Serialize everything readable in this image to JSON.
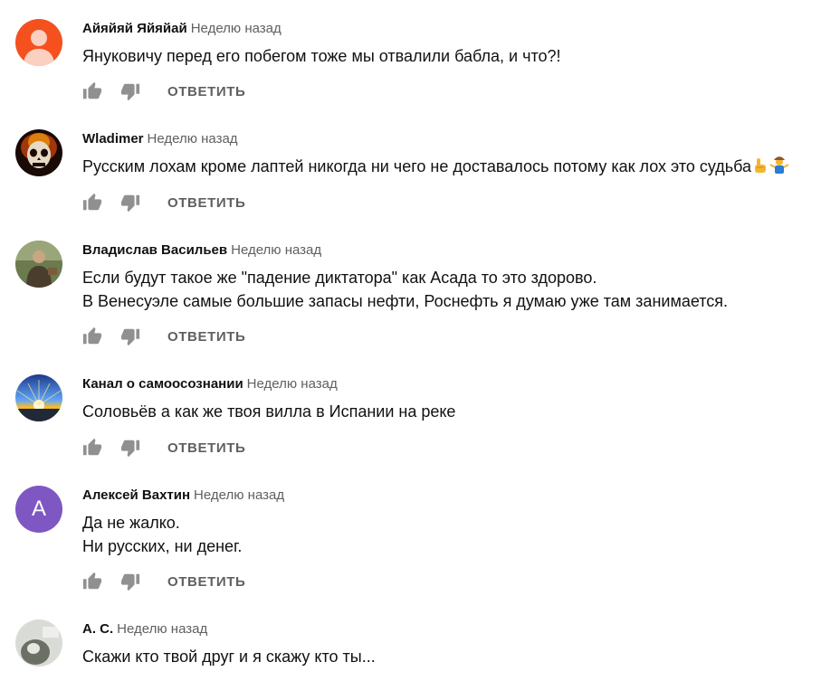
{
  "comments": [
    {
      "author": "Айяйяй Яйяйай",
      "time": "Неделю назад",
      "lines": [
        "Януковичу перед его побегом тоже мы отвалили бабла, и что?!"
      ],
      "reply": "ОТВЕТИТЬ",
      "avatar_icon": "default-person-avatar",
      "avatar_color": "#f4511e"
    },
    {
      "author": "Wladimer",
      "time": "Неделю назад",
      "lines": [
        "Русским лохам кроме лаптей никогда ни чего не доставалось потому как лох это судьба"
      ],
      "reply": "ОТВЕТИТЬ",
      "avatar_icon": "flaming-skull-avatar",
      "emojis": [
        "pointing-finger-emoji",
        "shrugging-person-emoji"
      ]
    },
    {
      "author": "Владислав Васильев",
      "time": "Неделю назад",
      "lines": [
        "Если будут такое же \"падение диктатора\" как Асада то это здорово.",
        "В Венесуэле самые большие запасы нефти, Роснефть я думаю уже там занимается."
      ],
      "reply": "ОТВЕТИТЬ",
      "avatar_icon": "person-photo-avatar"
    },
    {
      "author": "Канал о самоосознании",
      "time": "Неделю назад",
      "lines": [
        "Соловьёв а как же твоя вилла в Испании на реке"
      ],
      "reply": "ОТВЕТИТЬ",
      "avatar_icon": "sunset-avatar"
    },
    {
      "author": "Алексей Вахтин",
      "time": "Неделю назад",
      "lines": [
        "Да не жалко.",
        "Ни русских, ни денег."
      ],
      "reply": "ОТВЕТИТЬ",
      "avatar_letter": "А",
      "avatar_color": "#7e57c2"
    },
    {
      "author": "А. С.",
      "time": "Неделю назад",
      "lines": [
        "Скажи кто твой друг и я скажу кто ты..."
      ],
      "avatar_icon": "cat-photo-avatar"
    }
  ]
}
